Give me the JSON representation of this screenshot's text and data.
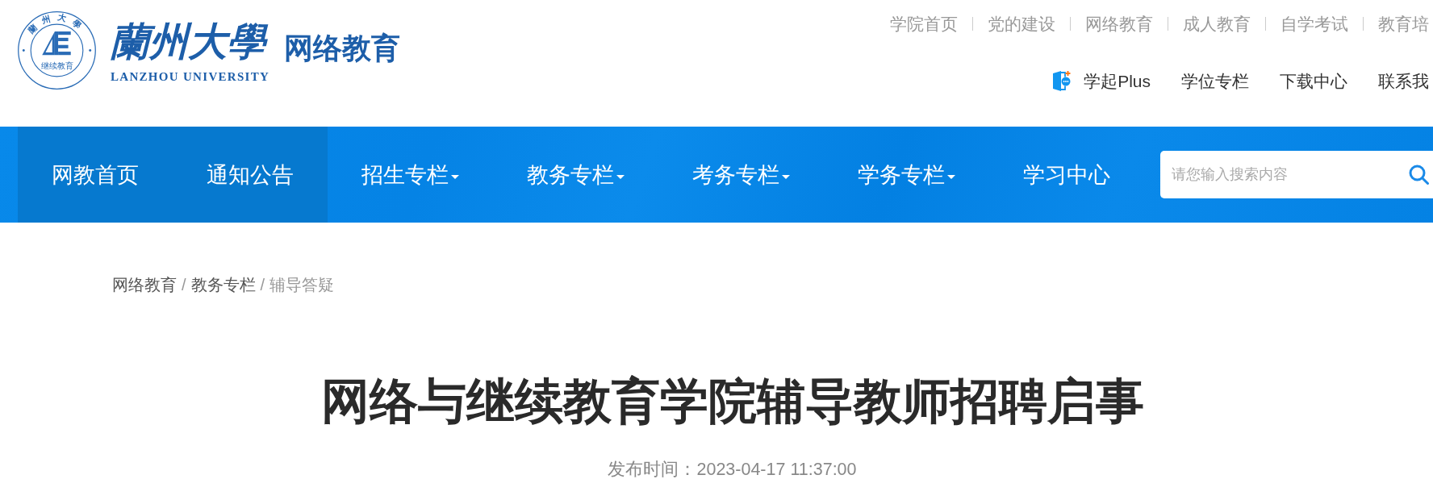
{
  "logo": {
    "seal_arc": "蘭州大學",
    "seal_caption": "继续教育",
    "name": "蘭州大學",
    "name_en": "LANZHOU UNIVERSITY",
    "section": "网络教育"
  },
  "top_links": [
    "学院首页",
    "党的建设",
    "网络教育",
    "成人教育",
    "自学考试",
    "教育培"
  ],
  "quick_links": [
    {
      "label": "学起Plus",
      "kind": "app"
    },
    {
      "label": "学位专栏",
      "kind": "text"
    },
    {
      "label": "下载中心",
      "kind": "text"
    },
    {
      "label": "联系我",
      "kind": "text"
    }
  ],
  "nav": {
    "items": [
      {
        "label": "网教首页",
        "selected": true,
        "dropdown": false
      },
      {
        "label": "通知公告",
        "selected": true,
        "dropdown": false
      },
      {
        "label": "招生专栏",
        "selected": false,
        "dropdown": true
      },
      {
        "label": "教务专栏",
        "selected": false,
        "dropdown": true
      },
      {
        "label": "考务专栏",
        "selected": false,
        "dropdown": true
      },
      {
        "label": "学务专栏",
        "selected": false,
        "dropdown": true
      },
      {
        "label": "学习中心",
        "selected": false,
        "dropdown": false
      }
    ],
    "search": {
      "placeholder": "请您输入搜索内容"
    }
  },
  "breadcrumb": {
    "items": [
      {
        "label": "网络教育",
        "current": false
      },
      {
        "label": "教务专栏",
        "current": false
      },
      {
        "label": "辅导答疑",
        "current": true
      }
    ],
    "separators": [
      "/",
      "/"
    ]
  },
  "article": {
    "title": "网络与继续教育学院辅导教师招聘启事",
    "published": "发布时间：2023-04-17 11:37:00"
  }
}
